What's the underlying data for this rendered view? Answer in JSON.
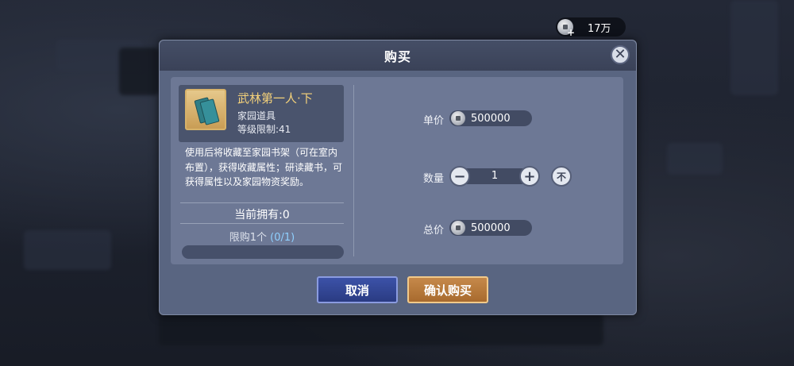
{
  "currency": {
    "icon": "silver-coin-icon",
    "amount": "17万"
  },
  "dialog": {
    "title": "购买",
    "close_icon": "close-icon",
    "item": {
      "name": "武林第一人·下",
      "type": "家园道具",
      "level_limit": "等级限制:41",
      "icon": "book-icon",
      "description": "使用后将收藏至家园书架（可在室内布置），获得收藏属性；研读藏书，可获得属性以及家园物资奖励。",
      "owned": "当前拥有:0",
      "limit_prefix": "限购1个",
      "limit_count": "(0/1)"
    },
    "unit_price": {
      "label": "单价",
      "value": "500000"
    },
    "quantity": {
      "label": "数量",
      "value": "1",
      "minus": "−",
      "plus": "+",
      "max": "不"
    },
    "total_price": {
      "label": "总价",
      "value": "500000"
    },
    "buttons": {
      "cancel": "取消",
      "confirm": "确认购买"
    }
  },
  "colors": {
    "item_name": "#f5d27a",
    "confirm": "#c6894a",
    "cancel": "#3c52a8"
  }
}
